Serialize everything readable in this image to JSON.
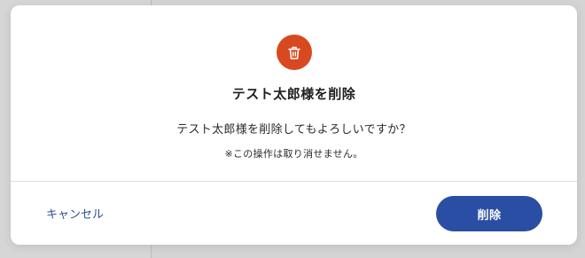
{
  "dialog": {
    "icon": "trash-icon",
    "title": "テスト太郎様を削除",
    "message": "テスト太郎様を削除してもよろしいですか？",
    "note": "※この操作は取り消せません。",
    "cancel_label": "キャンセル",
    "confirm_label": "削除"
  },
  "colors": {
    "danger": "#d9491f",
    "primary": "#2a4ea3",
    "link": "#2c4f9f"
  }
}
